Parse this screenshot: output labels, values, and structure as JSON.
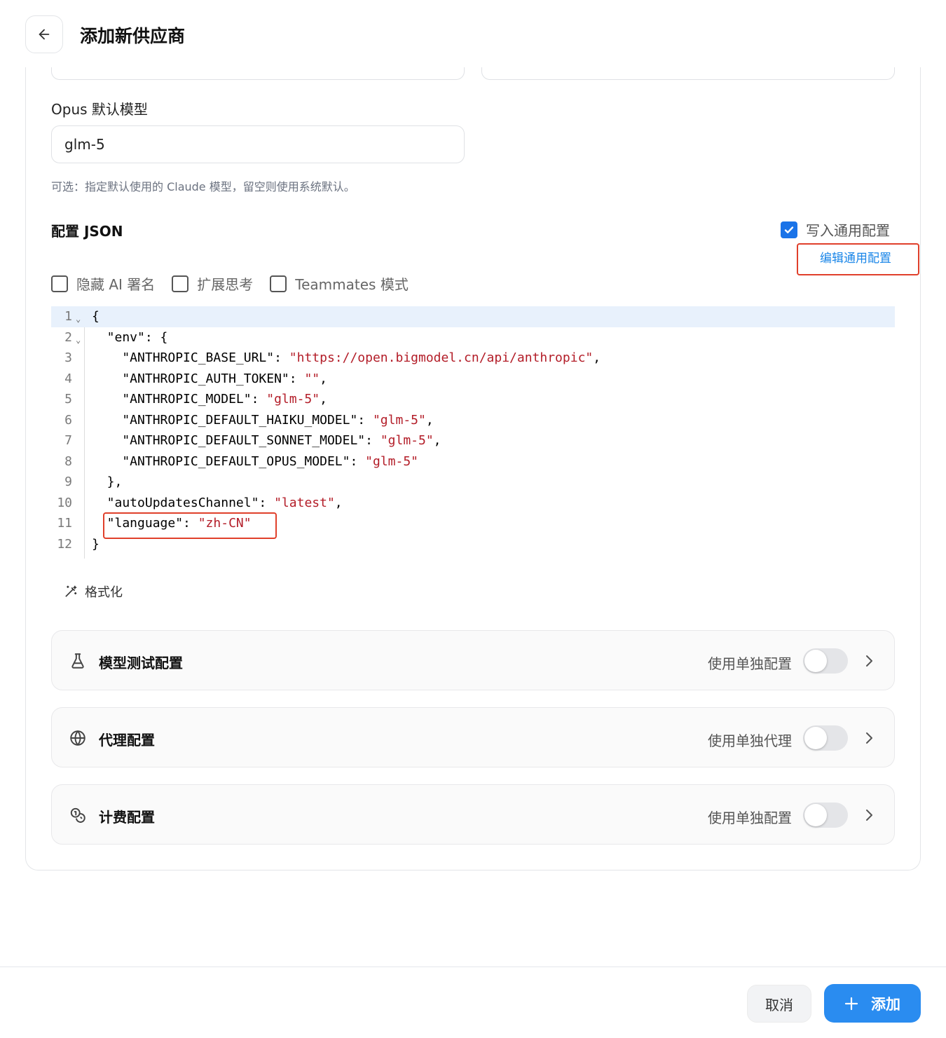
{
  "header": {
    "title": "添加新供应商",
    "back_icon": "arrow-left-icon"
  },
  "form": {
    "opus_label": "Opus 默认模型",
    "opus_value": "glm-5",
    "hint": "可选：指定默认使用的 Claude 模型，留空则使用系统默认。",
    "json_label": "配置 JSON",
    "write_common_label": "写入通用配置",
    "write_common_checked": true,
    "edit_common_link": "编辑通用配置",
    "options": [
      {
        "label": "隐藏 AI 署名",
        "checked": false
      },
      {
        "label": "扩展思考",
        "checked": false
      },
      {
        "label": "Teammates 模式",
        "checked": false
      }
    ],
    "format_label": "格式化"
  },
  "editor": {
    "lines": [
      {
        "n": "1",
        "parts": [
          "{"
        ]
      },
      {
        "n": "2",
        "parts": [
          "  \"env\": {"
        ]
      },
      {
        "n": "3",
        "parts": [
          "    \"ANTHROPIC_BASE_URL\": ",
          "\"https://open.bigmodel.cn/api/anthropic\"",
          ","
        ]
      },
      {
        "n": "4",
        "parts": [
          "    \"ANTHROPIC_AUTH_TOKEN\": ",
          "\"\"",
          ","
        ]
      },
      {
        "n": "5",
        "parts": [
          "    \"ANTHROPIC_MODEL\": ",
          "\"glm-5\"",
          ","
        ]
      },
      {
        "n": "6",
        "parts": [
          "    \"ANTHROPIC_DEFAULT_HAIKU_MODEL\": ",
          "\"glm-5\"",
          ","
        ]
      },
      {
        "n": "7",
        "parts": [
          "    \"ANTHROPIC_DEFAULT_SONNET_MODEL\": ",
          "\"glm-5\"",
          ","
        ]
      },
      {
        "n": "8",
        "parts": [
          "    \"ANTHROPIC_DEFAULT_OPUS_MODEL\": ",
          "\"glm-5\"",
          ""
        ]
      },
      {
        "n": "9",
        "parts": [
          "  },"
        ]
      },
      {
        "n": "10",
        "parts": [
          "  \"autoUpdatesChannel\": ",
          "\"latest\"",
          ","
        ]
      },
      {
        "n": "11",
        "parts": [
          "  \"language\": ",
          "\"zh-CN\"",
          ""
        ]
      },
      {
        "n": "12",
        "parts": [
          "}"
        ]
      }
    ]
  },
  "sections": [
    {
      "title": "模型测试配置",
      "toggle_label": "使用单独配置",
      "icon": "flask-icon",
      "on": false
    },
    {
      "title": "代理配置",
      "toggle_label": "使用单独代理",
      "icon": "globe-icon",
      "on": false
    },
    {
      "title": "计费配置",
      "toggle_label": "使用单独配置",
      "icon": "coins-icon",
      "on": false
    }
  ],
  "footer": {
    "cancel_label": "取消",
    "add_label": "添加"
  },
  "colors": {
    "accent": "#2a8cf0",
    "link": "#1a86e8",
    "string": "#b31d28",
    "highlight": "#e0402b"
  }
}
